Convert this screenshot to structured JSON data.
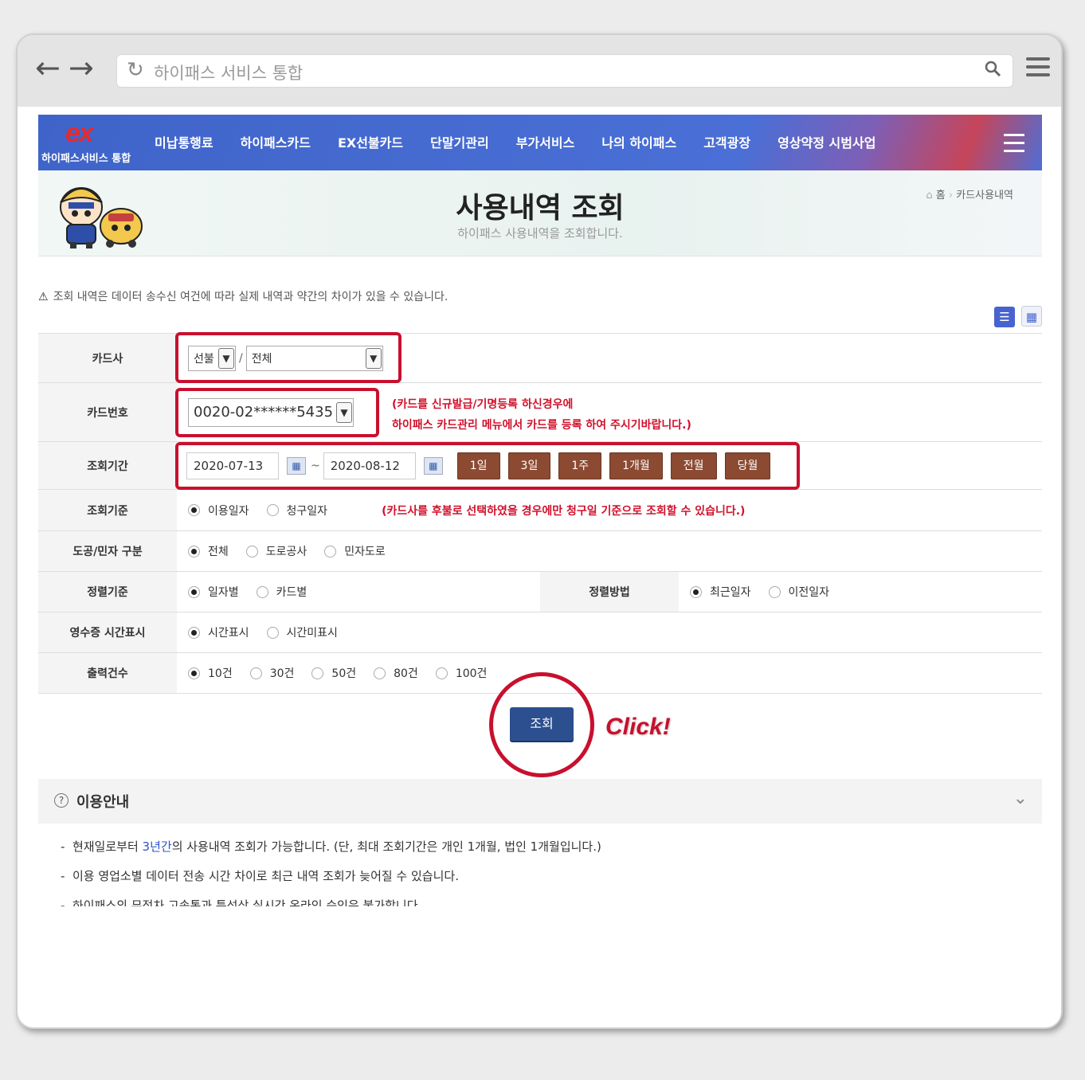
{
  "browser": {
    "url_text": "하이패스 서비스 통합",
    "back_icon": "←",
    "forward_icon": "→"
  },
  "header": {
    "logo_mark": "ex",
    "logo_sub": "하이패스서비스 통합",
    "menu": [
      "미납통행료",
      "하이패스카드",
      "EX선불카드",
      "단말기관리",
      "부가서비스",
      "나의 하이패스",
      "고객광장",
      "영상약정 시범사업"
    ]
  },
  "banner": {
    "title": "사용내역 조회",
    "subtitle": "하이패스 사용내역을 조회합니다.",
    "breadcrumb_home": "홈",
    "breadcrumb_current": "카드사용내역"
  },
  "notice": "조회 내역은 데이터 송수신 여건에 따라 실제 내역과 약간의 차이가 있을 수 있습니다.",
  "form": {
    "card_company": {
      "label": "카드사",
      "type_value": "선불",
      "company_value": "전체"
    },
    "card_number": {
      "label": "카드번호",
      "value": "0020-02******5435",
      "note_line1": "(카드를 신규발급/기명등록 하신경우에",
      "note_line2": "하이패스 카드관리 메뉴에서 카드를 등록 하여 주시기바랍니다.)"
    },
    "period": {
      "label": "조회기간",
      "start": "2020-07-13",
      "sep": "~",
      "end": "2020-08-12",
      "buttons": [
        "1일",
        "3일",
        "1주",
        "1개월",
        "전월",
        "당월"
      ]
    },
    "basis": {
      "label": "조회기준",
      "options": [
        "이용일자",
        "청구일자"
      ],
      "selected": 0,
      "note": "(카드사를 후불로 선택하였을 경우에만 청구일 기준으로 조회할 수 있습니다.)"
    },
    "road_type": {
      "label": "도공/민자 구분",
      "options": [
        "전체",
        "도로공사",
        "민자도로"
      ],
      "selected": 0
    },
    "sort_basis": {
      "label": "정렬기준",
      "options": [
        "일자별",
        "카드별"
      ],
      "selected": 0
    },
    "sort_method": {
      "label": "정렬방법",
      "options": [
        "최근일자",
        "이전일자"
      ],
      "selected": 0
    },
    "receipt_time": {
      "label": "영수증 시간표시",
      "options": [
        "시간표시",
        "시간미표시"
      ],
      "selected": 0
    },
    "output_count": {
      "label": "출력건수",
      "options": [
        "10건",
        "30건",
        "50건",
        "80건",
        "100건"
      ],
      "selected": 0
    }
  },
  "submit": {
    "label": "조회",
    "annotation": "Click!"
  },
  "guide": {
    "title": "이용안내",
    "line1_pre": "현재일로부터 ",
    "line1_hl": "3년간",
    "line1_post": "의 사용내역 조회가 가능합니다. (단, 최대 조회기간은 개인 1개월, 법인 1개월입니다.)",
    "line2": "이용 영업소별 데이터 전송 시간 차이로 최근 내역 조회가 늦어질 수 있습니다.",
    "line3": "하이패스의 무정차 고속통과 특성상 실시간 온라인 승인은 불가합니다."
  },
  "colors": {
    "nav_blue": "#4a6fd6",
    "annotation_red": "#c8102e",
    "period_button": "#8c4a32",
    "submit_button": "#2b4f8f"
  }
}
